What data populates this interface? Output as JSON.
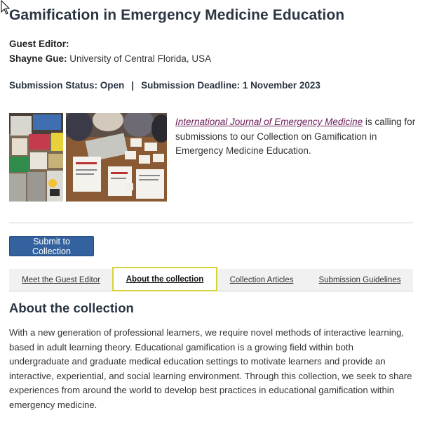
{
  "page": {
    "title": "Gamification in Emergency Medicine Education",
    "guest_editor_label": "Guest Editor:",
    "editor_name": "Shayne Gue:",
    "editor_affiliation": "University of Central Florida, USA",
    "submission_status": "Submission Status: Open",
    "separator": "|",
    "submission_deadline": "Submission Deadline: 1 November 2023",
    "intro_link": "International Journal of Emergency Medicine",
    "intro_text": " is calling for submissions to our Collection on Gamification in Emergency Medicine Education.",
    "submit_button": "Submit to Collection"
  },
  "tabs": [
    {
      "label": "Meet the Guest Editor",
      "active": false
    },
    {
      "label": "About the collection",
      "active": true
    },
    {
      "label": "Collection Articles",
      "active": false
    },
    {
      "label": "Submission Guidelines",
      "active": false
    }
  ],
  "section": {
    "heading": "About the collection",
    "body": "With a new generation of professional learners, we require novel methods of interactive learning, based in adult learning theory. Educational gamification is a growing field within both undergraduate and graduate medical education settings to motivate learners and provide an interactive, experiential, and social learning environment. Through this collection, we seek to share experiences from around the world to develop best practices in educational gamification within emergency medicine."
  },
  "icons": {
    "cursor": "mouse-pointer-icon"
  },
  "colors": {
    "heading": "#2b3543",
    "link": "#6b1d5a",
    "button": "#33629e",
    "active_tab_border": "#d8d33b"
  }
}
